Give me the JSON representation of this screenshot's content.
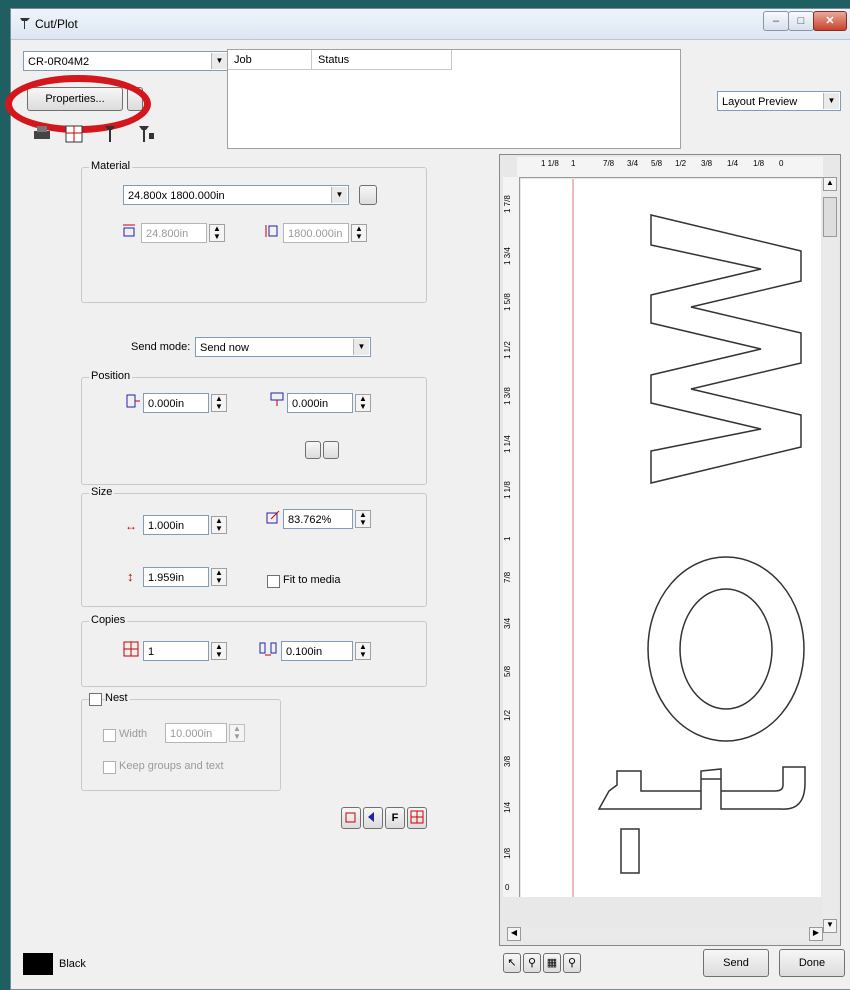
{
  "window": {
    "title": "Cut/Plot",
    "controls": [
      "minimize",
      "maximize",
      "close"
    ]
  },
  "device": {
    "selected": "CR-0R04M2"
  },
  "buttons": {
    "properties": "Properties...",
    "send": "Send",
    "done": "Done"
  },
  "job_table": {
    "columns": [
      "Job",
      "Status"
    ]
  },
  "view_select": {
    "value": "Layout Preview"
  },
  "material": {
    "group_label": "Material",
    "size": "24.800x 1800.000in",
    "width": "24.800in",
    "length": "1800.000in"
  },
  "send_mode": {
    "label": "Send mode:",
    "value": "Send now"
  },
  "position": {
    "group_label": "Position",
    "x": "0.000in",
    "y": "0.000in"
  },
  "size": {
    "group_label": "Size",
    "width": "1.000in",
    "height": "1.959in",
    "scale": "83.762%",
    "fit_label": "Fit to media",
    "fit_checked": false
  },
  "copies": {
    "group_label": "Copies",
    "count": "1",
    "spacing": "0.100in"
  },
  "nest": {
    "label": "Nest",
    "checked": false,
    "width_label": "Width",
    "width_value": "10.000in",
    "keep_groups_label": "Keep groups and text"
  },
  "ruler": {
    "top": [
      "1 1/8",
      "1",
      "7/8",
      "3/4",
      "5/8",
      "1/2",
      "3/8",
      "1/4",
      "1/8",
      "0"
    ],
    "left": [
      "1 7/8",
      "1 3/4",
      "1 5/8",
      "1 1/2",
      "1 3/8",
      "1 1/4",
      "1 1/8",
      "1",
      "7/8",
      "3/4",
      "5/8",
      "1/2",
      "3/8",
      "1/4",
      "1/8",
      "0"
    ]
  },
  "preview": {
    "text": "tow"
  },
  "color": {
    "swatch": "#000000",
    "name": "Black"
  },
  "annotation": {
    "circle_color": "#d4161d"
  }
}
